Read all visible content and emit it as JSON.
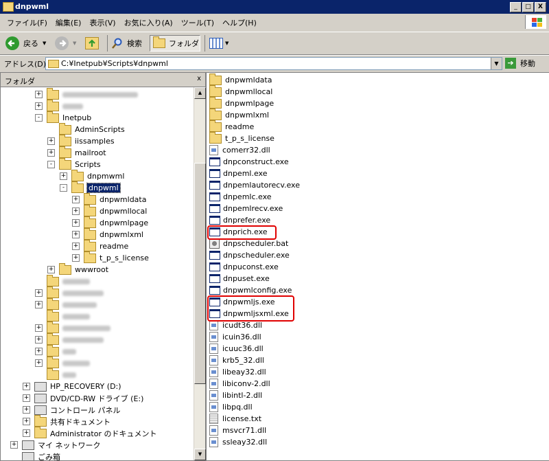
{
  "window": {
    "title": "dnpwml"
  },
  "title_buttons": {
    "minimize": "_",
    "maximize": "□",
    "close": "X"
  },
  "menu": [
    "ファイル(F)",
    "編集(E)",
    "表示(V)",
    "お気に入り(A)",
    "ツール(T)",
    "ヘルプ(H)"
  ],
  "toolbar": {
    "back": "戻る",
    "search": "検索",
    "folders": "フォルダ"
  },
  "address": {
    "label": "アドレス(D)",
    "value": "C:¥Inetpub¥Scripts¥dnpwml",
    "go": "移動"
  },
  "folder_pane": {
    "title": "フォルダ",
    "close": "x"
  },
  "tree": [
    {
      "label": "",
      "indent": 1,
      "pm": "+",
      "blur": 110
    },
    {
      "label": "",
      "indent": 1,
      "pm": "+",
      "blur": 30
    },
    {
      "label": "Inetpub",
      "indent": 1,
      "pm": "-"
    },
    {
      "label": "AdminScripts",
      "indent": 2,
      "pm": ""
    },
    {
      "label": "iissamples",
      "indent": 2,
      "pm": "+"
    },
    {
      "label": "mailroot",
      "indent": 2,
      "pm": "+"
    },
    {
      "label": "Scripts",
      "indent": 2,
      "pm": "-"
    },
    {
      "label": "dnpmwml",
      "indent": 3,
      "pm": "+"
    },
    {
      "label": "dnpwml",
      "indent": 3,
      "pm": "-",
      "selected": true
    },
    {
      "label": "dnpwmldata",
      "indent": 4,
      "pm": "+"
    },
    {
      "label": "dnpwmllocal",
      "indent": 4,
      "pm": "+"
    },
    {
      "label": "dnpwmlpage",
      "indent": 4,
      "pm": "+"
    },
    {
      "label": "dnpwmlxml",
      "indent": 4,
      "pm": "+"
    },
    {
      "label": "readme",
      "indent": 4,
      "pm": "+"
    },
    {
      "label": "t_p_s_license",
      "indent": 4,
      "pm": "+"
    },
    {
      "label": "wwwroot",
      "indent": 2,
      "pm": "+"
    },
    {
      "label": "",
      "indent": 1,
      "pm": "",
      "blur": 40
    },
    {
      "label": "",
      "indent": 1,
      "pm": "+",
      "blur": 60
    },
    {
      "label": "",
      "indent": 1,
      "pm": "+",
      "blur": 50
    },
    {
      "label": "",
      "indent": 1,
      "pm": "",
      "blur": 40
    },
    {
      "label": "",
      "indent": 1,
      "pm": "+",
      "blur": 70
    },
    {
      "label": "",
      "indent": 1,
      "pm": "+",
      "blur": 60
    },
    {
      "label": "",
      "indent": 1,
      "pm": "+",
      "blur": 20
    },
    {
      "label": "",
      "indent": 1,
      "pm": "+",
      "blur": 40
    },
    {
      "label": "",
      "indent": 1,
      "pm": "",
      "blur": 20
    },
    {
      "label": "HP_RECOVERY (D:)",
      "indent": 0,
      "pm": "+",
      "icon": "drive"
    },
    {
      "label": "DVD/CD-RW ドライブ (E:)",
      "indent": 0,
      "pm": "+",
      "icon": "drive"
    },
    {
      "label": "コントロール パネル",
      "indent": 0,
      "pm": "+",
      "icon": "panel"
    },
    {
      "label": "共有ドキュメント",
      "indent": 0,
      "pm": "+"
    },
    {
      "label": "Administrator のドキュメント",
      "indent": 0,
      "pm": "+"
    },
    {
      "label": "マイ ネットワーク",
      "indent": -1,
      "pm": "+",
      "icon": "net"
    },
    {
      "label": "ごみ箱",
      "indent": -1,
      "pm": "",
      "icon": "trash"
    }
  ],
  "files": [
    {
      "name": "dnpwmldata",
      "type": "folder"
    },
    {
      "name": "dnpwmllocal",
      "type": "folder"
    },
    {
      "name": "dnpwmlpage",
      "type": "folder"
    },
    {
      "name": "dnpwmlxml",
      "type": "folder"
    },
    {
      "name": "readme",
      "type": "folder"
    },
    {
      "name": "t_p_s_license",
      "type": "folder"
    },
    {
      "name": "comerr32.dll",
      "type": "dll"
    },
    {
      "name": "dnpconstruct.exe",
      "type": "exe"
    },
    {
      "name": "dnpeml.exe",
      "type": "exe"
    },
    {
      "name": "dnpemlautorecv.exe",
      "type": "exe"
    },
    {
      "name": "dnpemlc.exe",
      "type": "exe"
    },
    {
      "name": "dnpemlrecv.exe",
      "type": "exe"
    },
    {
      "name": "dnprefer.exe",
      "type": "exe"
    },
    {
      "name": "dnprich.exe",
      "type": "exe",
      "highlight": true
    },
    {
      "name": "dnpscheduler.bat",
      "type": "bat"
    },
    {
      "name": "dnpscheduler.exe",
      "type": "exe"
    },
    {
      "name": "dnpuconst.exe",
      "type": "exe"
    },
    {
      "name": "dnpuset.exe",
      "type": "exe"
    },
    {
      "name": "dnpwmlconfig.exe",
      "type": "exe"
    },
    {
      "name": "dnpwmljs.exe",
      "type": "exe",
      "highlight": true
    },
    {
      "name": "dnpwmljsxml.exe",
      "type": "exe",
      "highlight": true
    },
    {
      "name": "icudt36.dll",
      "type": "dll"
    },
    {
      "name": "icuin36.dll",
      "type": "dll"
    },
    {
      "name": "icuuc36.dll",
      "type": "dll"
    },
    {
      "name": "krb5_32.dll",
      "type": "dll"
    },
    {
      "name": "libeay32.dll",
      "type": "dll"
    },
    {
      "name": "libiconv-2.dll",
      "type": "dll"
    },
    {
      "name": "libintl-2.dll",
      "type": "dll"
    },
    {
      "name": "libpq.dll",
      "type": "dll"
    },
    {
      "name": "license.txt",
      "type": "txt"
    },
    {
      "name": "msvcr71.dll",
      "type": "dll"
    },
    {
      "name": "ssleay32.dll",
      "type": "dll"
    }
  ],
  "colors": {
    "titlebar": "#0a246a",
    "highlight_box": "#e00000",
    "selection": "#0a246a"
  }
}
